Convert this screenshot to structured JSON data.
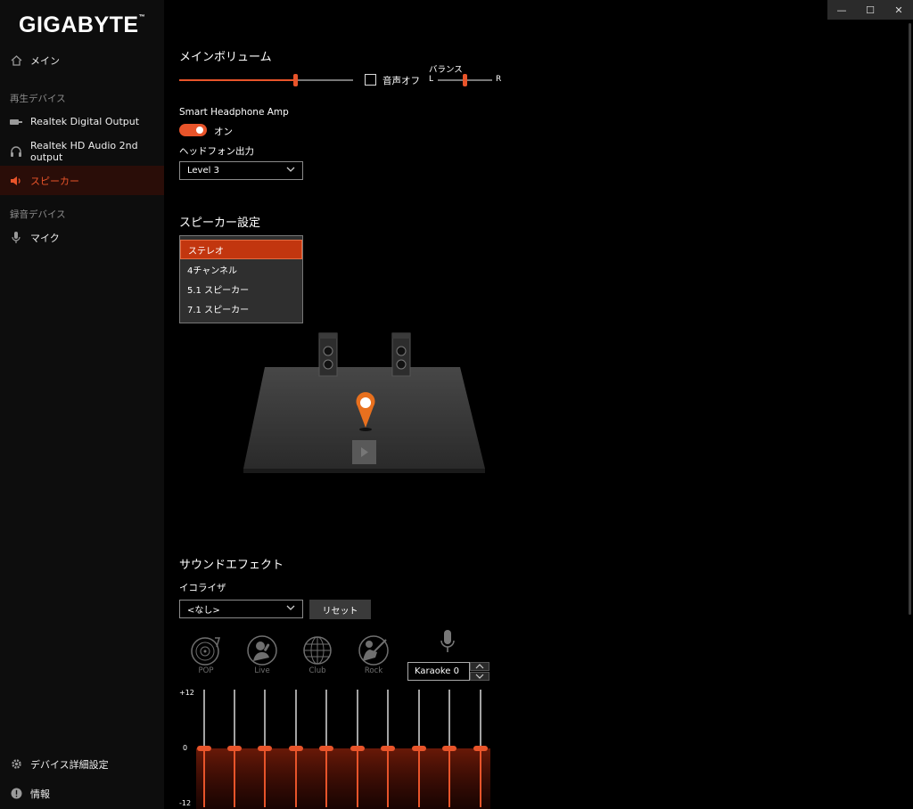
{
  "app": {
    "logo": "GIGABYTE",
    "logo_mark": "™"
  },
  "window_controls": {
    "minimize": "—",
    "maximize": "☐",
    "close": "✕"
  },
  "sidebar": {
    "main_item": "メイン",
    "playback_section": "再生デバイス",
    "playback_items": [
      "Realtek Digital Output",
      "Realtek HD Audio 2nd output",
      "スピーカー"
    ],
    "active_item": "スピーカー",
    "recording_section": "録音デバイス",
    "recording_items": [
      "マイク"
    ],
    "device_settings": "デバイス詳細設定",
    "info": "情報"
  },
  "main_volume": {
    "title": "メインボリューム",
    "level": 0.67,
    "mute_label": "音声オフ",
    "mute_checked": false,
    "balance_label": "バランス",
    "balance_left": "L",
    "balance_right": "R",
    "balance_position": 0.5
  },
  "headphone": {
    "amp_label": "Smart Headphone Amp",
    "toggle_label": "オン",
    "toggle_on": true,
    "output_label": "ヘッドフォン出力",
    "output_value": "Level 3"
  },
  "speaker_settings": {
    "title": "スピーカー設定",
    "options": [
      "ステレオ",
      "4チャンネル",
      "5.1 スピーカー",
      "7.1 スピーカー"
    ],
    "selected": "ステレオ"
  },
  "sound_effects": {
    "title": "サウンドエフェクト",
    "eq_label": "イコライザ",
    "eq_value": "<なし>",
    "reset_button": "リセット",
    "presets": [
      "POP",
      "Live",
      "Club",
      "Rock"
    ],
    "karaoke_value": "Karaoke 0",
    "eq_scale_top": "+12",
    "eq_scale_mid": "0",
    "eq_scale_bottom": "-12",
    "eq_bands": [
      0,
      0,
      0,
      0,
      0,
      0,
      0,
      0,
      0,
      0
    ]
  },
  "colors": {
    "accent": "#e8542a",
    "active_bg": "#2a0d08",
    "sidebar_bg": "#0d0d0d"
  }
}
